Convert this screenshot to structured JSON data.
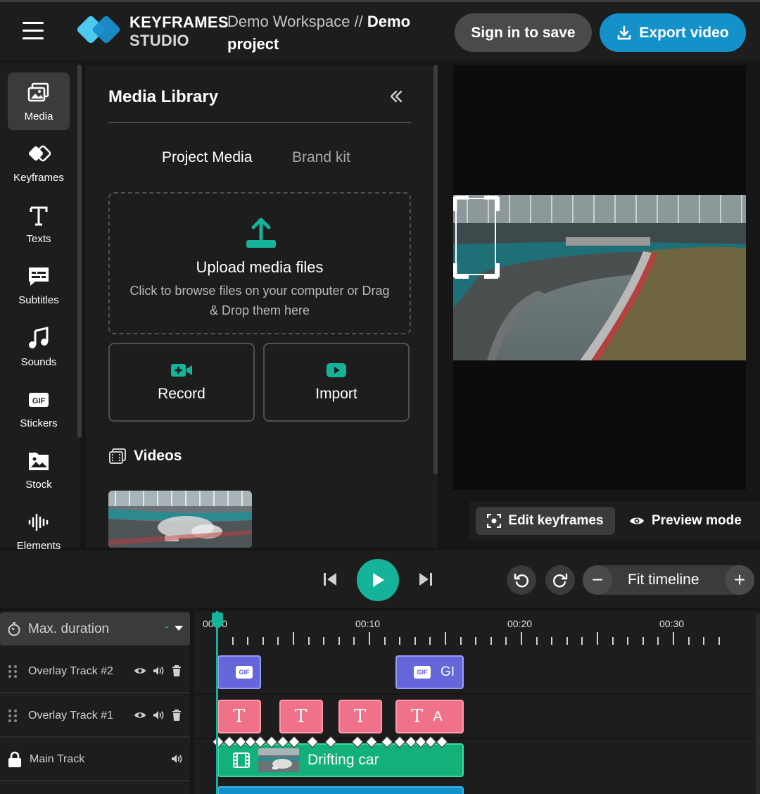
{
  "header": {
    "brand_line1": "KEYFRAMES",
    "brand_line2": "STUDIO",
    "workspace": "Demo Workspace //",
    "project": "Demo project",
    "sign_in_label": "Sign in to save",
    "export_label": "Export video"
  },
  "sidebar": {
    "items": [
      {
        "label": "Media",
        "icon": "media-icon",
        "active": true
      },
      {
        "label": "Keyframes",
        "icon": "keyframes-icon"
      },
      {
        "label": "Texts",
        "icon": "text-icon"
      },
      {
        "label": "Subtitles",
        "icon": "subtitles-icon"
      },
      {
        "label": "Sounds",
        "icon": "music-note-icon"
      },
      {
        "label": "Stickers",
        "icon": "gif-icon"
      },
      {
        "label": "Stock",
        "icon": "image-icon"
      },
      {
        "label": "Elements",
        "icon": "waveform-icon"
      }
    ]
  },
  "media_panel": {
    "title": "Media Library",
    "tabs": [
      "Project Media",
      "Brand kit"
    ],
    "active_tab": "Project Media",
    "upload_title": "Upload media files",
    "upload_subtitle": "Click to browse files on your computer or Drag & Drop them here",
    "record_label": "Record",
    "import_label": "Import",
    "videos_heading": "Videos"
  },
  "preview": {
    "edit_keyframes_label": "Edit keyframes",
    "preview_mode_label": "Preview mode"
  },
  "transport": {
    "fit_timeline_label": "Fit timeline",
    "zoom_out_symbol": "−",
    "zoom_in_symbol": "+"
  },
  "timeline": {
    "max_duration_label": "Max. duration",
    "max_duration_value": "-",
    "ruler_labels": [
      "00:00",
      "00:10",
      "00:20",
      "00:30"
    ],
    "tracks": [
      {
        "name": "Overlay Track #2",
        "type": "overlay"
      },
      {
        "name": "Overlay Track #1",
        "type": "overlay"
      },
      {
        "name": "Main Track",
        "type": "main"
      }
    ],
    "gif_clip_label": "GI",
    "text_clip_glyph": "T",
    "text_clip_extra": "A",
    "main_clip_label": "Drifting car"
  },
  "colors": {
    "accent": "#15b49a",
    "export": "#1591c9",
    "gif_clip": "#6566d9",
    "text_clip": "#f0728a",
    "main_clip": "#13b07a"
  }
}
